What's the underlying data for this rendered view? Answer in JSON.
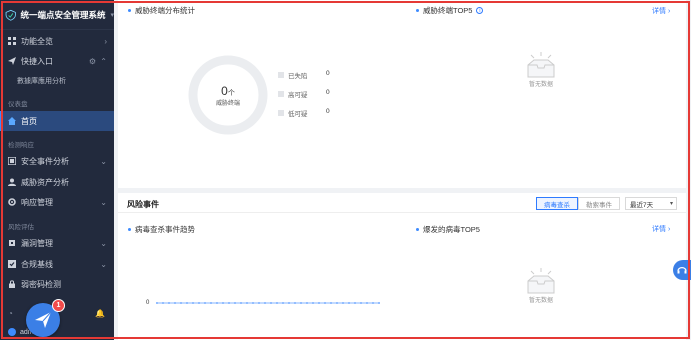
{
  "app": {
    "title": "统一端点安全管理系统"
  },
  "sidebar": {
    "items": [
      {
        "label": "功能全览",
        "icon": "grid-icon",
        "chevron": "›"
      },
      {
        "label": "快捷入口",
        "icon": "send-icon",
        "chevron": "^"
      },
      {
        "label": "數據庫應用分析",
        "icon": ""
      }
    ],
    "sections": [
      "仪表盘",
      "检测响应",
      "风险评估"
    ],
    "home": {
      "label": "首页",
      "icon": "home-icon"
    },
    "detect_items": [
      {
        "label": "安全事件分析",
        "icon": "shield-icon",
        "chevron": "⌄"
      },
      {
        "label": "威胁资产分析",
        "icon": "user-icon",
        "chevron": ""
      },
      {
        "label": "响应管理",
        "icon": "gear-icon",
        "chevron": "⌄"
      }
    ],
    "risk_items": [
      {
        "label": "漏洞管理",
        "icon": "bug-icon",
        "chevron": "⌄"
      },
      {
        "label": "合规基线",
        "icon": "checklist-icon",
        "chevron": "⌄"
      },
      {
        "label": "弱密码检测",
        "icon": "lock-icon",
        "chevron": ""
      }
    ],
    "user": {
      "name": "admin"
    },
    "badge_count": "1"
  },
  "top_panel": {
    "left_title": "威胁终端分布统计",
    "right_title": "威胁终端TOP5",
    "detail_link": "详情 ›",
    "donut": {
      "value": "0",
      "unit": "个",
      "label": "威胁终端"
    },
    "legend": [
      {
        "label": "已失陷",
        "value": "0"
      },
      {
        "label": "高可疑",
        "value": "0"
      },
      {
        "label": "低可疑",
        "value": "0"
      }
    ],
    "empty_text": "暂无数据"
  },
  "bottom_panel": {
    "title": "风险事件",
    "segments": [
      "病毒查杀",
      "勒索事件"
    ],
    "range": "最近7天",
    "left_title": "病毒查杀事件趋势",
    "right_title": "爆发的病毒TOP5",
    "detail_link": "详情 ›",
    "zero_tick": "0",
    "empty_text": "暂无数据"
  },
  "colors": {
    "sidebar_bg": "#222a3d",
    "accent": "#2f7bff",
    "active_bg": "#2b4a7e",
    "badge": "#f24b4b",
    "frame": "#e53935"
  }
}
